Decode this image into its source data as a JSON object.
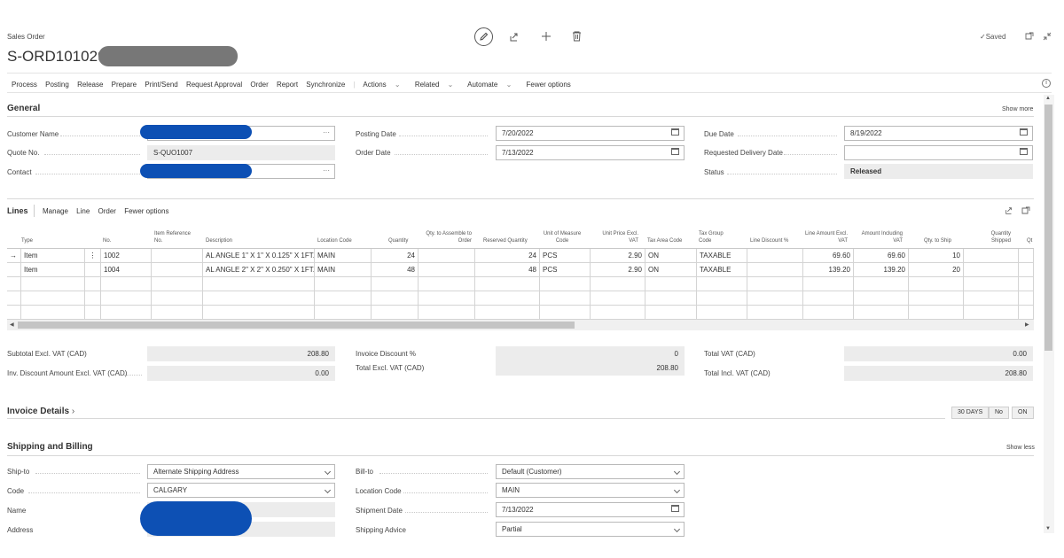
{
  "header": {
    "page_type": "Sales Order",
    "order_no": "S-ORD101029",
    "saved_label": "Saved"
  },
  "menu": {
    "items": [
      "Process",
      "Posting",
      "Release",
      "Prepare",
      "Print/Send",
      "Request Approval",
      "Order",
      "Report",
      "Synchronize"
    ],
    "actions": "Actions",
    "related": "Related",
    "automate": "Automate",
    "fewer": "Fewer options"
  },
  "general": {
    "title": "General",
    "show_more": "Show more",
    "customer_name_label": "Customer Name",
    "quote_no_label": "Quote No.",
    "quote_no": "S-QUO1007",
    "contact_label": "Contact",
    "posting_date_label": "Posting Date",
    "posting_date": "7/20/2022",
    "order_date_label": "Order Date",
    "order_date": "7/13/2022",
    "due_date_label": "Due Date",
    "due_date": "8/19/2022",
    "req_delivery_label": "Requested Delivery Date",
    "req_delivery": "",
    "status_label": "Status",
    "status": "Released"
  },
  "lines": {
    "title": "Lines",
    "tabs": [
      "Manage",
      "Line",
      "Order",
      "Fewer options"
    ],
    "columns": {
      "type": "Type",
      "no": "No.",
      "item_ref": "Item Reference No.",
      "description": "Description",
      "location": "Location Code",
      "quantity": "Quantity",
      "qty_assemble": "Qty. to Assemble to Order",
      "reserved": "Reserved Quantity",
      "uom": "Unit of Measure Code",
      "unit_price": "Unit Price Excl. VAT",
      "tax_area": "Tax Area Code",
      "tax_group": "Tax Group Code",
      "line_discount": "Line Discount %",
      "line_amount": "Line Amount Excl. VAT",
      "amount_incl": "Amount Including VAT",
      "qty_ship": "Qty. to Ship",
      "qty_shipped": "Quantity Shipped",
      "extra": "Qt"
    },
    "rows": [
      {
        "type": "Item",
        "no": "1002",
        "item_ref": "",
        "description": "AL ANGLE 1\" X 1\" X 0.125\" X 1FT...",
        "location": "MAIN",
        "quantity": "24",
        "qty_assemble": "",
        "reserved": "24",
        "uom": "PCS",
        "unit_price": "2.90",
        "tax_area": "ON",
        "tax_group": "TAXABLE",
        "line_discount": "",
        "line_amount": "69.60",
        "amount_incl": "69.60",
        "qty_ship": "10",
        "qty_shipped": ""
      },
      {
        "type": "Item",
        "no": "1004",
        "item_ref": "",
        "description": "AL ANGLE 2\" X 2\" X 0.250\" X 1FT...",
        "location": "MAIN",
        "quantity": "48",
        "qty_assemble": "",
        "reserved": "48",
        "uom": "PCS",
        "unit_price": "2.90",
        "tax_area": "ON",
        "tax_group": "TAXABLE",
        "line_discount": "",
        "line_amount": "139.20",
        "amount_incl": "139.20",
        "qty_ship": "20",
        "qty_shipped": ""
      }
    ]
  },
  "totals": {
    "subtotal_label": "Subtotal Excl. VAT (CAD)",
    "subtotal": "208.80",
    "inv_disc_amt_label": "Inv. Discount Amount Excl. VAT (CAD)",
    "inv_disc_amt": "0.00",
    "inv_disc_pct_label": "Invoice Discount %",
    "inv_disc_pct": "0",
    "total_excl_label": "Total Excl. VAT (CAD)",
    "total_excl": "208.80",
    "total_vat_label": "Total VAT (CAD)",
    "total_vat": "0.00",
    "total_incl_label": "Total Incl. VAT (CAD)",
    "total_incl": "208.80"
  },
  "invoice": {
    "title": "Invoice Details",
    "chips": [
      "30 DAYS",
      "No",
      "ON"
    ]
  },
  "shipping": {
    "title": "Shipping and Billing",
    "show_less": "Show less",
    "ship_to_label": "Ship-to",
    "ship_to": "Alternate Shipping Address",
    "code_label": "Code",
    "code": "CALGARY",
    "name_label": "Name",
    "address_label": "Address",
    "bill_to_label": "Bill-to",
    "bill_to": "Default (Customer)",
    "location_label": "Location Code",
    "location": "MAIN",
    "shipment_date_label": "Shipment Date",
    "shipment_date": "7/13/2022",
    "shipping_advice_label": "Shipping Advice",
    "shipping_advice": "Partial"
  }
}
